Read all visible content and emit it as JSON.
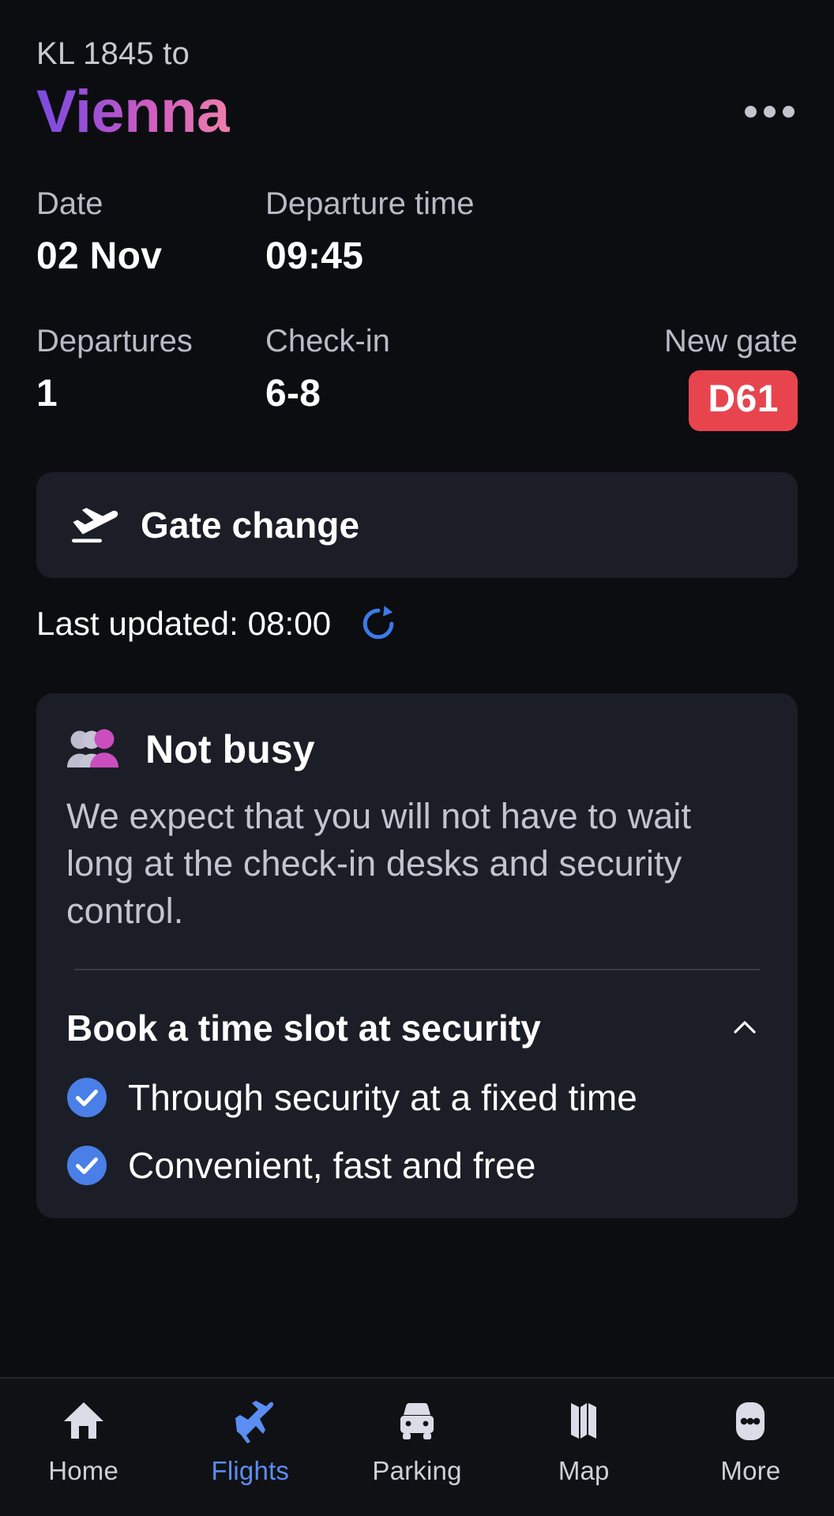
{
  "theme": {
    "page_bg": "#0C0D11",
    "card_bg": "#1B1E26",
    "accent_blue": "#4A7FE8",
    "alert_red": "#E8444E",
    "gradient_from": "#7A4BDF",
    "gradient_to": "#EF7FAC",
    "magenta": "#CC4EBE",
    "muted_text": "#C3C4D0"
  },
  "header": {
    "flight_line": "KL 1845 to",
    "destination": "Vienna",
    "menu_icon": "kebab-menu-icon"
  },
  "flight_info": {
    "row1": [
      {
        "label": "Date",
        "value": "02 Nov"
      },
      {
        "label": "Departure time",
        "value": "09:45"
      }
    ],
    "row2": [
      {
        "label": "Departures",
        "value": "1"
      },
      {
        "label": "Check-in",
        "value": "6-8"
      },
      {
        "label": "New gate",
        "value": "D61",
        "badge": true
      }
    ]
  },
  "alert": {
    "icon": "flight-takeoff-icon",
    "title": "Gate change"
  },
  "last_updated": {
    "text": "Last updated: 08:00",
    "refresh_icon": "refresh-icon"
  },
  "busy_card": {
    "icon": "people-group-icon",
    "status_title": "Not busy",
    "description": "We expect that you will not have to wait long at the check-in desks and security control.",
    "accordion": {
      "title": "Book a time slot at security",
      "chevron_icon": "chevron-up-icon",
      "expanded": true,
      "items": [
        {
          "icon": "check-circle-icon",
          "label": "Through security at a fixed time"
        },
        {
          "icon": "check-circle-icon",
          "label": "Convenient, fast and free"
        }
      ]
    }
  },
  "bottom_nav": {
    "active_index": 1,
    "items": [
      {
        "icon": "home-icon",
        "label": "Home"
      },
      {
        "icon": "flight-icon",
        "label": "Flights"
      },
      {
        "icon": "car-icon",
        "label": "Parking"
      },
      {
        "icon": "map-icon",
        "label": "Map"
      },
      {
        "icon": "more-dots-icon",
        "label": "More"
      }
    ]
  }
}
